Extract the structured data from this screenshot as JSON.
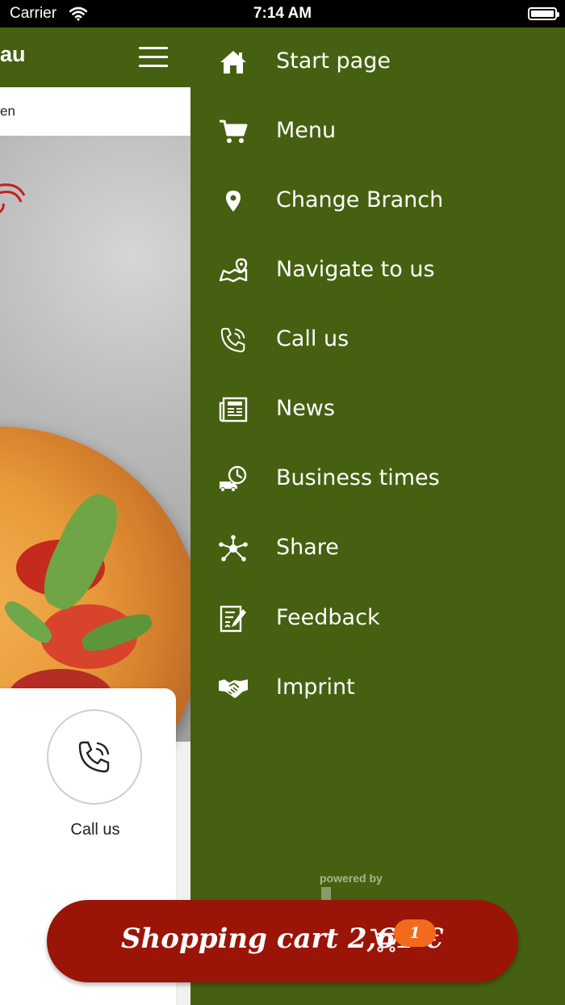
{
  "status_bar": {
    "carrier": "Carrier",
    "time": "7:14 AM"
  },
  "main": {
    "title_partial": "au",
    "info_partial": "en",
    "call_action_label": "Call us"
  },
  "drawer": {
    "items": [
      {
        "label": "Start page",
        "icon": "home-icon"
      },
      {
        "label": "Menu",
        "icon": "cart-icon"
      },
      {
        "label": "Change Branch",
        "icon": "location-pin-icon"
      },
      {
        "label": "Navigate to us",
        "icon": "map-icon"
      },
      {
        "label": "Call us",
        "icon": "phone-icon"
      },
      {
        "label": "News",
        "icon": "newspaper-icon"
      },
      {
        "label": "Business times",
        "icon": "delivery-clock-icon"
      },
      {
        "label": "Share",
        "icon": "share-icon"
      },
      {
        "label": "Feedback",
        "icon": "feedback-icon"
      },
      {
        "label": "Imprint",
        "icon": "handshake-icon"
      }
    ],
    "powered_by": "powered by"
  },
  "cart": {
    "label": "Shopping cart 2,61 €",
    "count": "1"
  },
  "colors": {
    "drawer_green": "#456010",
    "cart_red": "#9b1408",
    "badge_orange": "#f26a1c"
  }
}
